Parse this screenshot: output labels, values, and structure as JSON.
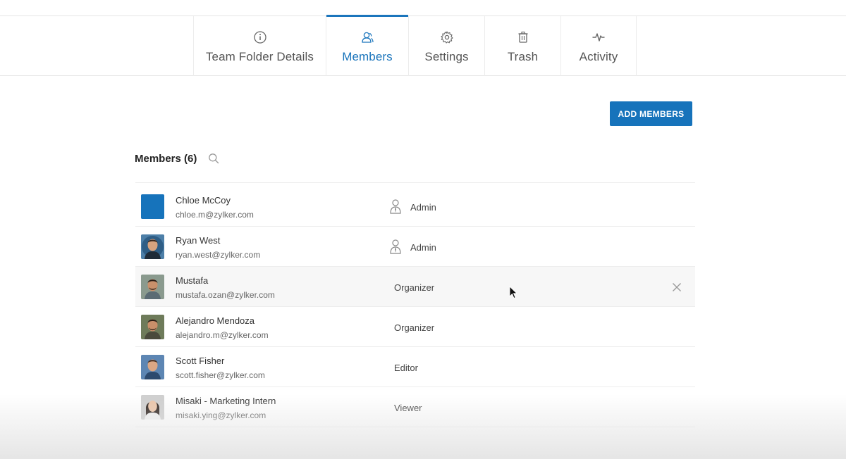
{
  "tabs": [
    {
      "label": "Team Folder Details",
      "icon": "info-icon",
      "active": false
    },
    {
      "label": "Members",
      "icon": "members-icon",
      "active": true
    },
    {
      "label": "Settings",
      "icon": "gear-icon",
      "active": false
    },
    {
      "label": "Trash",
      "icon": "trash-icon",
      "active": false
    },
    {
      "label": "Activity",
      "icon": "activity-icon",
      "active": false
    }
  ],
  "toolbar": {
    "add_members_label": "ADD MEMBERS"
  },
  "members_section": {
    "title": "Members (6)",
    "search_icon": "search-icon"
  },
  "members": [
    {
      "name": "Chloe McCoy",
      "email": "chloe.m@zylker.com",
      "role": "Admin",
      "role_icon": "admin-person-icon"
    },
    {
      "name": "Ryan West",
      "email": "ryan.west@zylker.com",
      "role": "Admin",
      "role_icon": "admin-person-icon"
    },
    {
      "name": "Mustafa",
      "email": "mustafa.ozan@zylker.com",
      "role": "Organizer",
      "role_icon": "",
      "hovered": true
    },
    {
      "name": "Alejandro Mendoza",
      "email": "alejandro.m@zylker.com",
      "role": "Organizer",
      "role_icon": ""
    },
    {
      "name": "Scott Fisher",
      "email": "scott.fisher@zylker.com",
      "role": "Editor",
      "role_icon": ""
    },
    {
      "name": "Misaki - Marketing Intern",
      "email": "misaki.ying@zylker.com",
      "role": "Viewer",
      "role_icon": ""
    }
  ],
  "colors": {
    "accent": "#1b75bc",
    "button": "#1673bb",
    "hover_row": "#f7f7f7"
  }
}
